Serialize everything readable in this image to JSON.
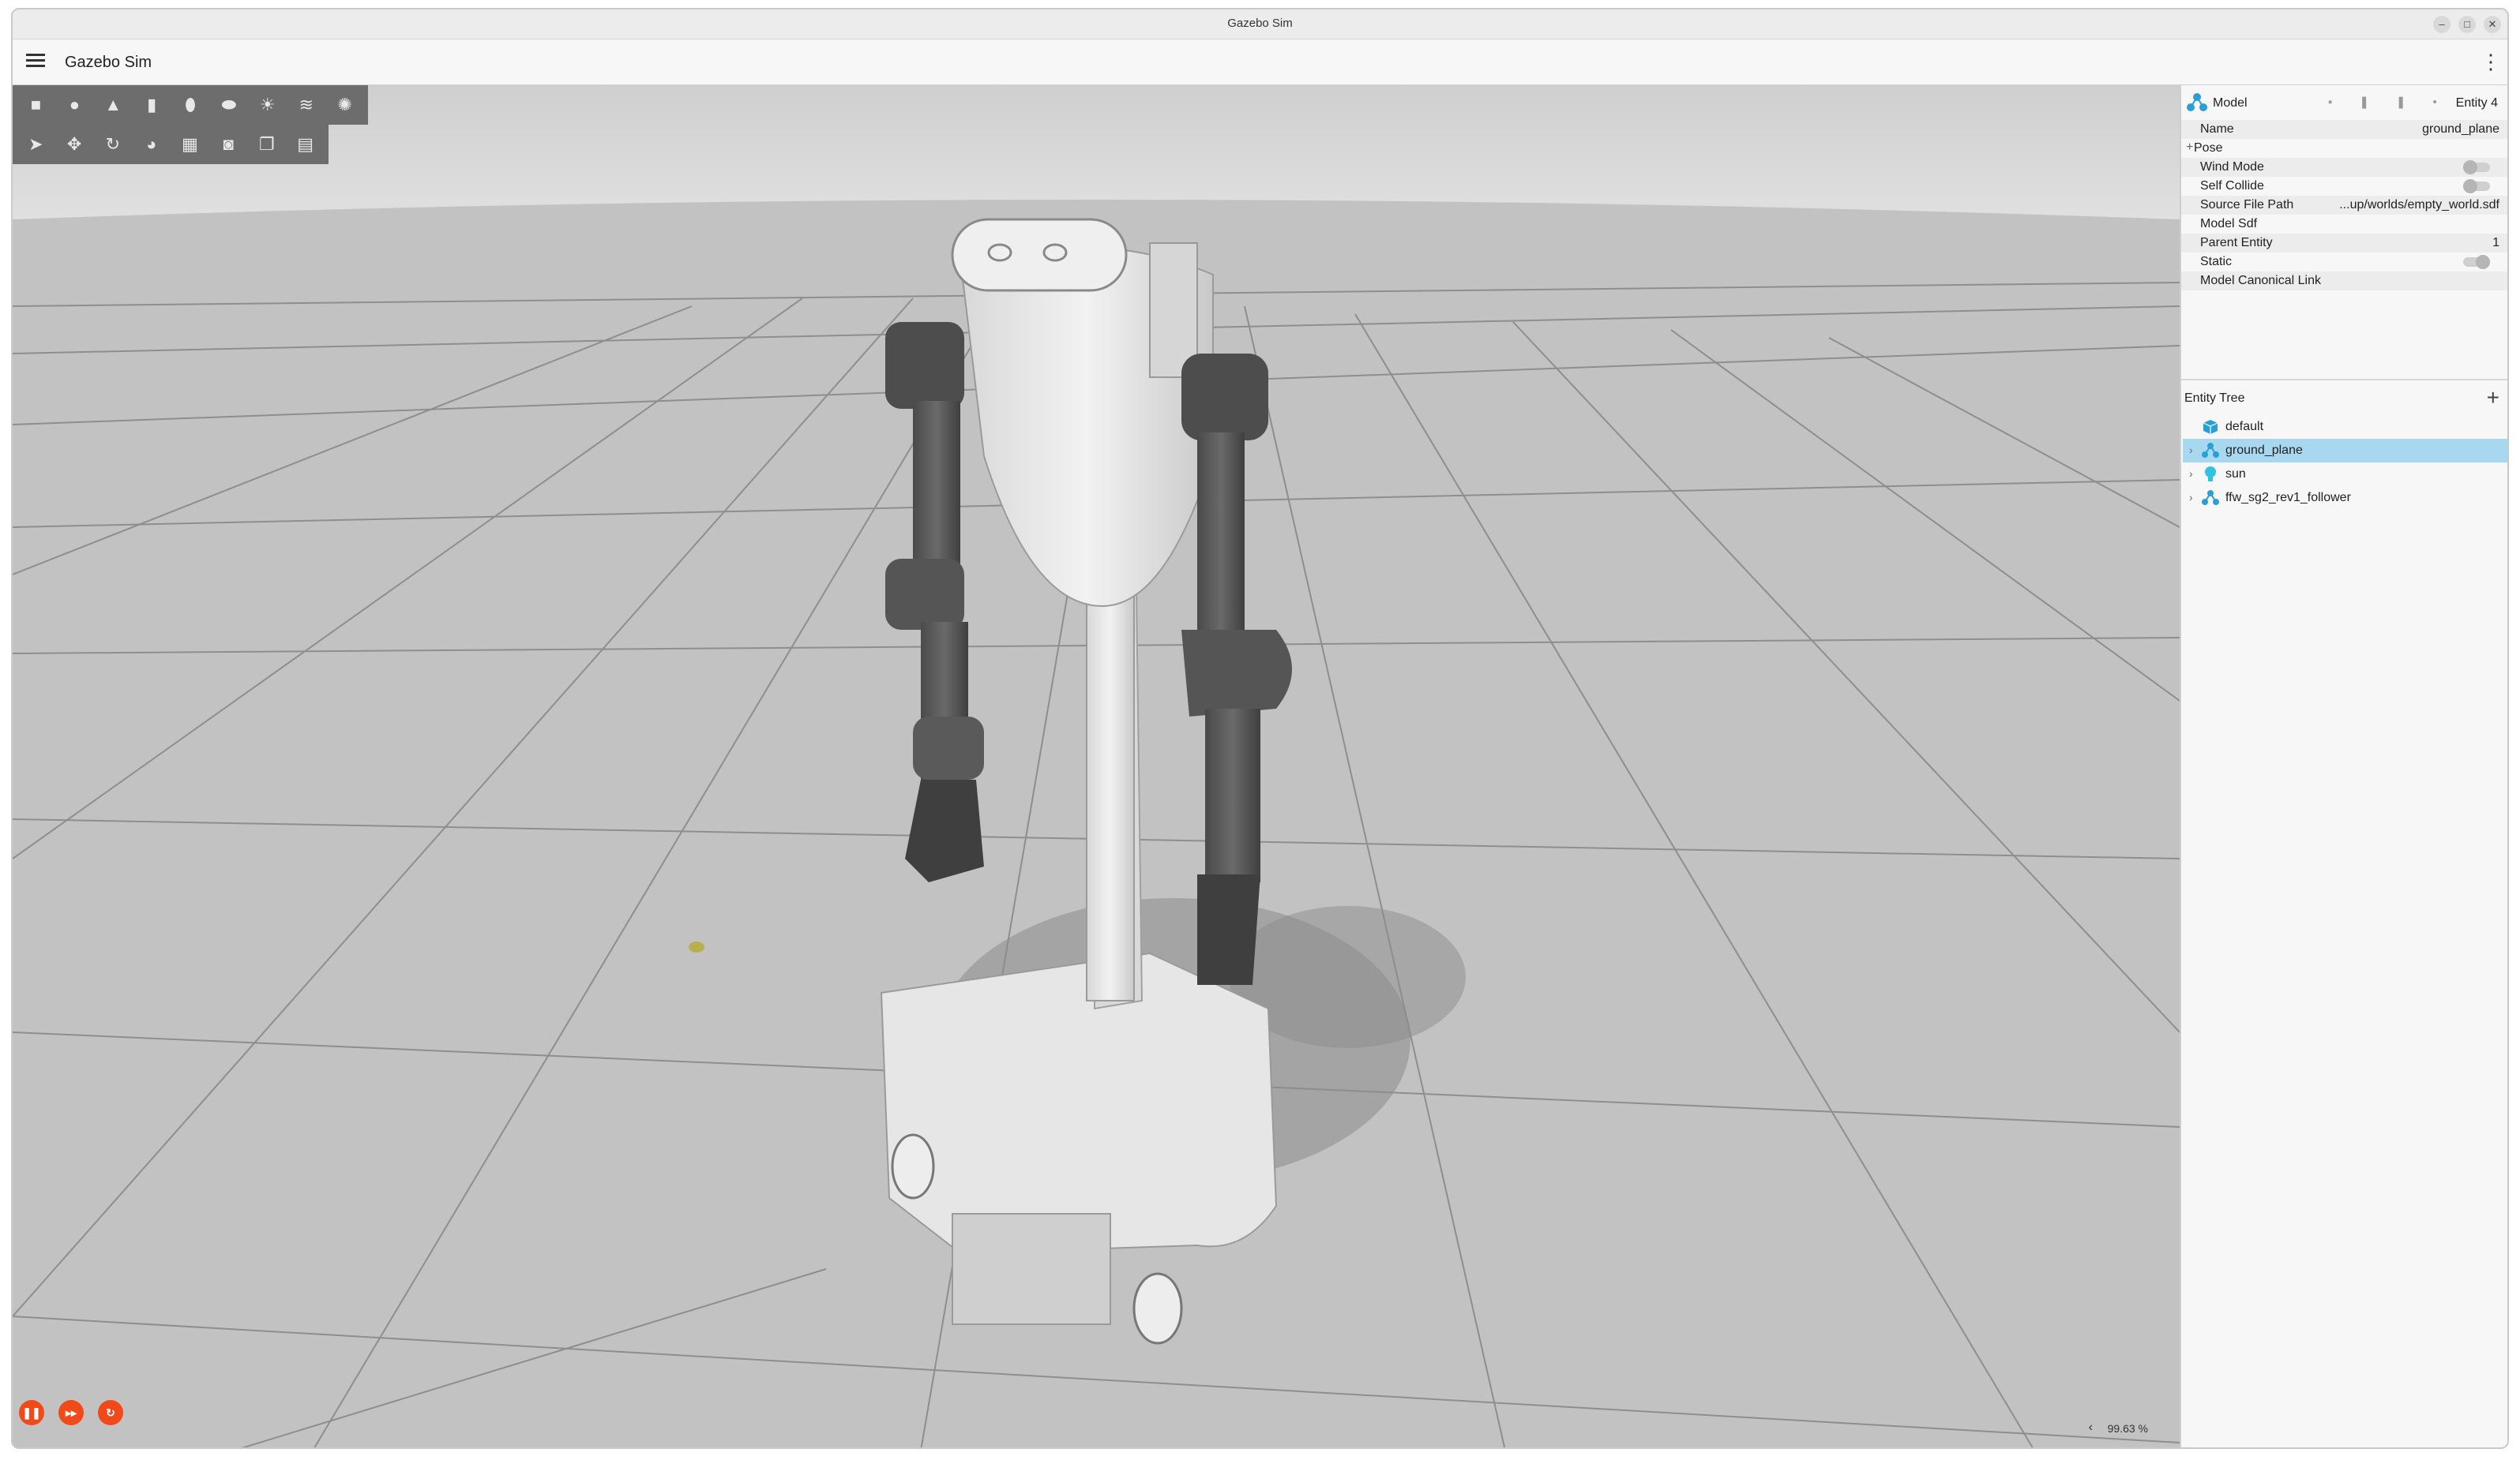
{
  "window": {
    "title": "Gazebo Sim"
  },
  "menubar": {
    "app_name": "Gazebo Sim"
  },
  "shapes_toolbar": [
    "box-icon",
    "sphere-icon",
    "cone-icon",
    "cylinder-icon",
    "capsule-icon",
    "ellipsoid-icon",
    "sun-icon",
    "directional-light-icon",
    "spot-light-icon"
  ],
  "transform_toolbar": [
    "select-icon",
    "translate-icon",
    "rotate-icon",
    "snap-icon",
    "grid-icon",
    "camera-icon",
    "copy-icon",
    "paste-icon"
  ],
  "component_inspector": {
    "model_label": "Model",
    "entity_label": "Entity 4",
    "rows": [
      {
        "key": "Name",
        "value": "ground_plane"
      },
      {
        "key": "Pose",
        "value": ""
      },
      {
        "key": "Wind Mode",
        "value": ""
      },
      {
        "key": "Self Collide",
        "value": ""
      },
      {
        "key": "Source File Path",
        "value": "...up/worlds/empty_world.sdf"
      },
      {
        "key": "Model Sdf",
        "value": ""
      },
      {
        "key": "Parent Entity",
        "value": "1"
      },
      {
        "key": "Static",
        "value": ""
      },
      {
        "key": "Model Canonical Link",
        "value": ""
      }
    ],
    "pose_expand": "+"
  },
  "entity_tree": {
    "title": "Entity Tree",
    "add": "+",
    "items": [
      {
        "name": "default",
        "icon": "world-cube-icon",
        "selected": false,
        "expandable": false
      },
      {
        "name": "ground_plane",
        "icon": "model-icon",
        "selected": true,
        "expandable": true
      },
      {
        "name": "sun",
        "icon": "light-bulb-icon",
        "selected": false,
        "expandable": true
      },
      {
        "name": "ffw_sg2_rev1_follower",
        "icon": "model-icon",
        "selected": false,
        "expandable": true
      }
    ]
  },
  "status": {
    "rtf": "99.63 %"
  },
  "colors": {
    "accent": "#f04a1a",
    "selection": "#a8d8f0",
    "toolbar": "#6d6d6d"
  }
}
